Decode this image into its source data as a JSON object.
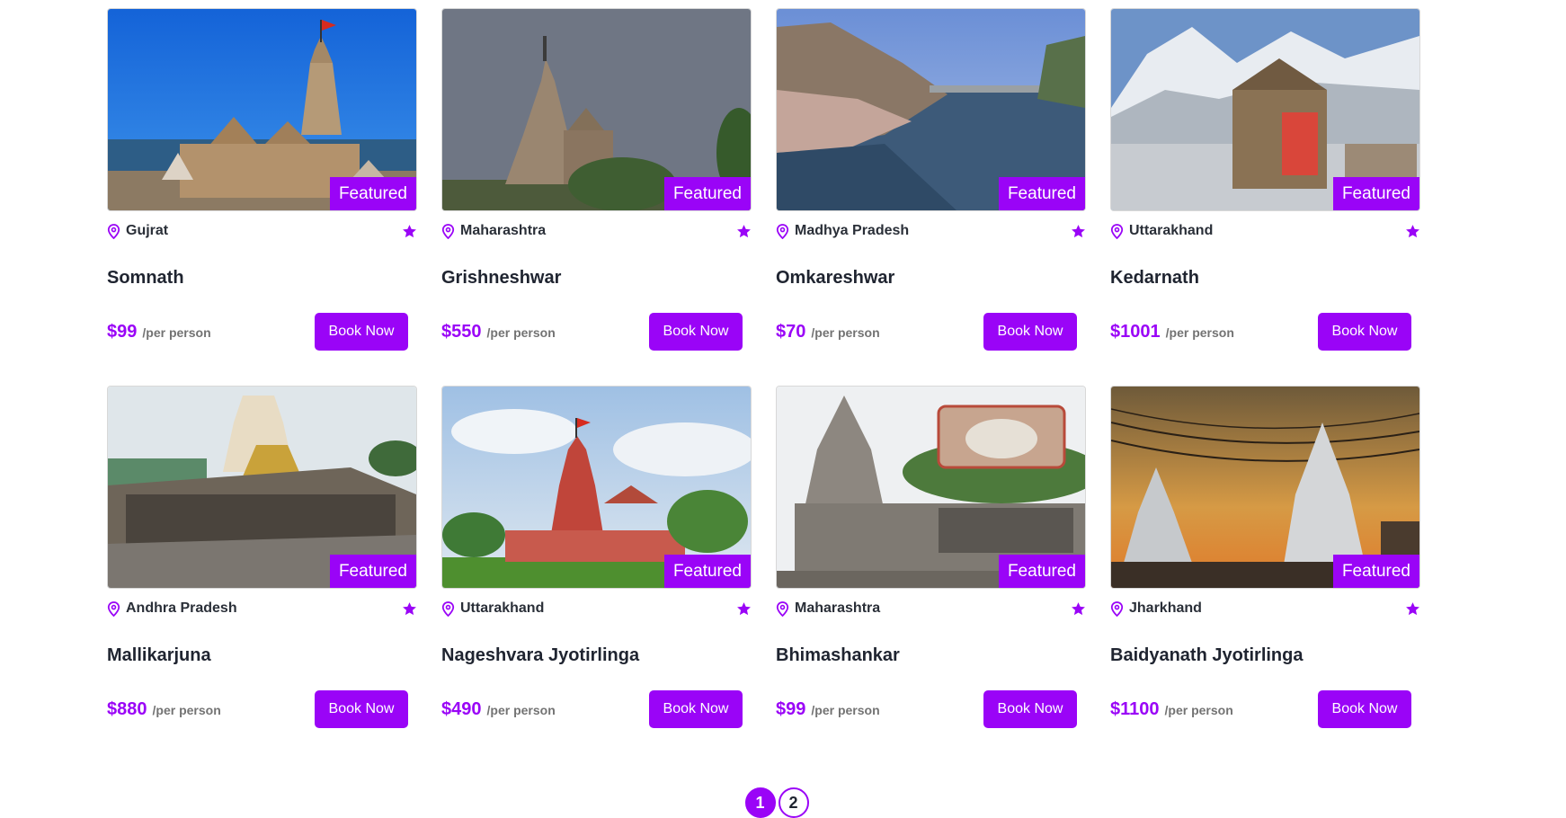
{
  "colors": {
    "accent": "#9a04f7",
    "text": "#1f2430",
    "muted": "#737373"
  },
  "cards": [
    {
      "location": "Gujrat",
      "title": "Somnath",
      "price": "$99",
      "per": "/per person",
      "badge": "Featured",
      "button": "Book Now",
      "image": "somnath-temple-seaside"
    },
    {
      "location": "Maharashtra",
      "title": "Grishneshwar",
      "price": "$550",
      "per": "/per person",
      "badge": "Featured",
      "button": "Book Now",
      "image": "grishneshwar-temple-grey-sky"
    },
    {
      "location": "Madhya Pradesh",
      "title": "Omkareshwar",
      "price": "$70",
      "per": "/per person",
      "badge": "Featured",
      "button": "Book Now",
      "image": "omkareshwar-river-ghats"
    },
    {
      "location": "Uttarakhand",
      "title": "Kedarnath",
      "price": "$1001",
      "per": "/per person",
      "badge": "Featured",
      "button": "Book Now",
      "image": "kedarnath-snow-mountains"
    },
    {
      "location": "Andhra Pradesh",
      "title": "Mallikarjuna",
      "price": "$880",
      "per": "/per person",
      "badge": "Featured",
      "button": "Book Now",
      "image": "mallikarjuna-gopuram"
    },
    {
      "location": "Uttarakhand",
      "title": "Nageshvara Jyotirlinga",
      "price": "$490",
      "per": "/per person",
      "badge": "Featured",
      "button": "Book Now",
      "image": "nageshvara-red-temple"
    },
    {
      "location": "Maharashtra",
      "title": "Bhimashankar",
      "price": "$99",
      "per": "/per person",
      "badge": "Featured",
      "button": "Book Now",
      "image": "bhimashankar-stone-temple"
    },
    {
      "location": "Jharkhand",
      "title": "Baidyanath Jyotirlinga",
      "price": "$1100",
      "per": "/per person",
      "badge": "Featured",
      "button": "Book Now",
      "image": "baidyanath-sunset-temple"
    }
  ],
  "pagination": {
    "pages": [
      "1",
      "2"
    ],
    "active": "1"
  }
}
